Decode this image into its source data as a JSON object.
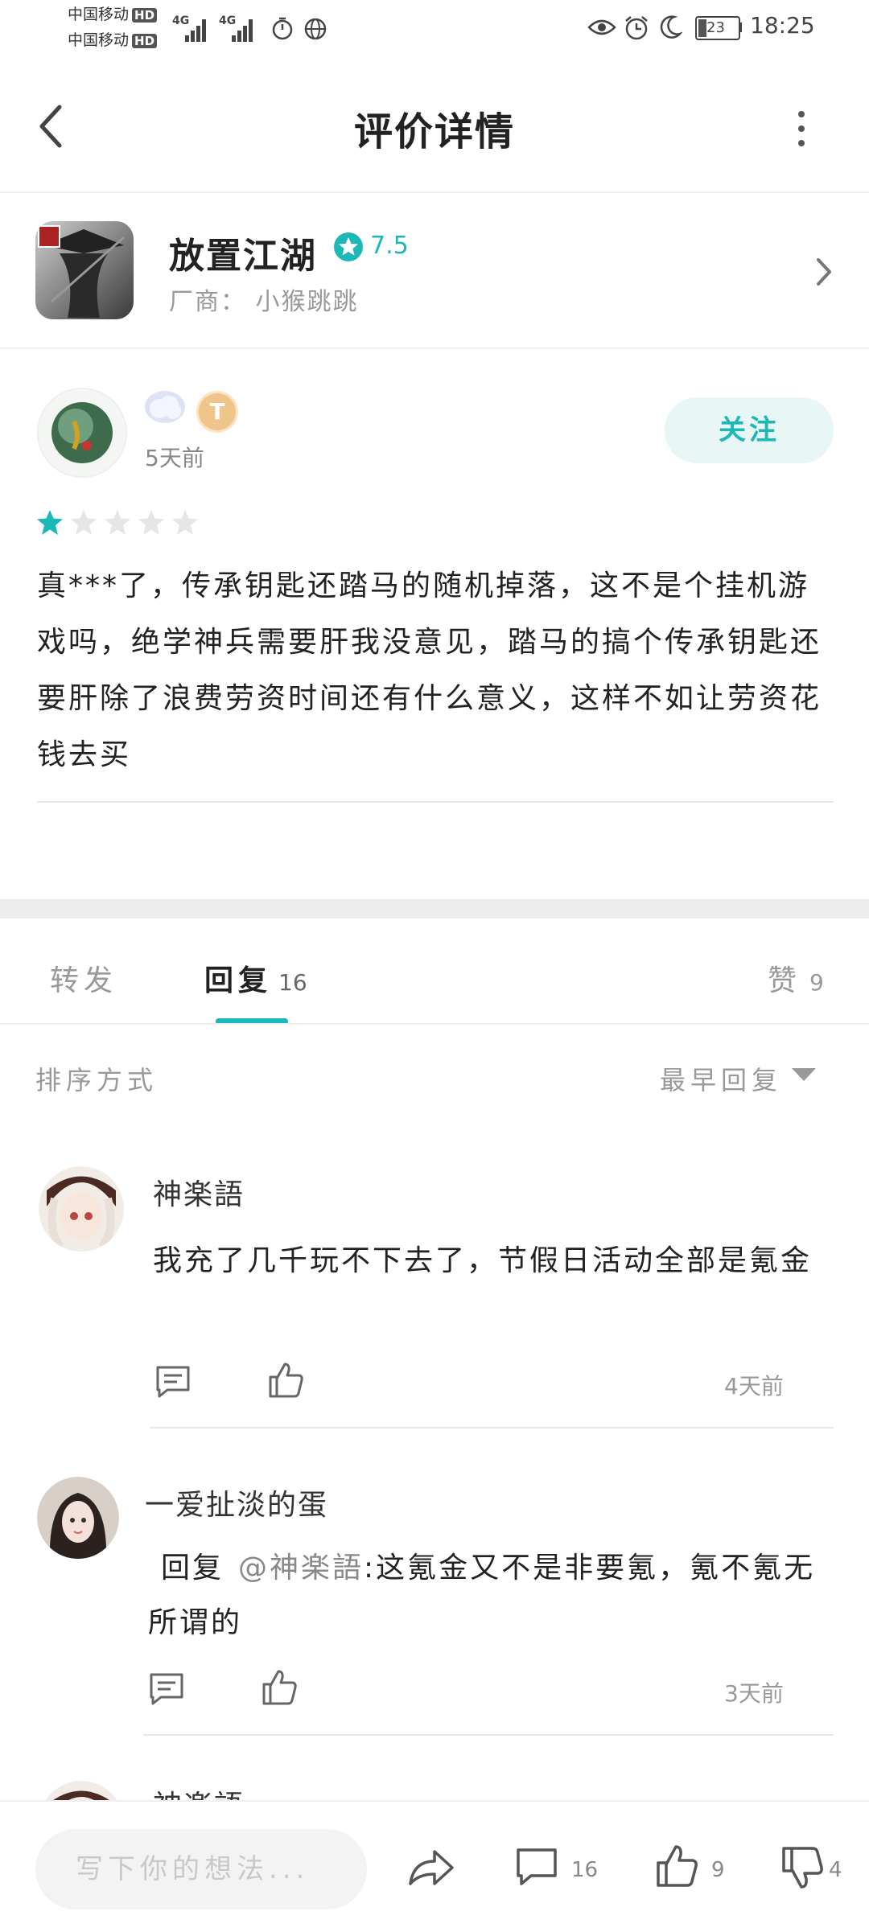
{
  "status_bar": {
    "carrier1": "中国移动",
    "carrier2": "中国移动",
    "hd": "HD",
    "net1": "4G",
    "net2": "4G",
    "battery": "23",
    "time": "18:25"
  },
  "header": {
    "title": "评价详情"
  },
  "game": {
    "name": "放置江湖",
    "score": "7.5",
    "maker": "厂商： 小猴跳跳"
  },
  "review": {
    "badge_letter": "T",
    "time": "5天前",
    "follow_label": "关注",
    "stars": 1,
    "stars_max": 5,
    "text": "真***了，传承钥匙还踏马的随机掉落，这不是个挂机游戏吗，绝学神兵需要肝我没意见，踏马的搞个传承钥匙还要肝除了浪费劳资时间还有什么意义，这样不如让劳资花钱去买"
  },
  "tabs": {
    "forward": "转发",
    "reply": "回复",
    "reply_count": "16",
    "like": "赞",
    "like_count": "9"
  },
  "sort": {
    "label": "排序方式",
    "value": "最早回复"
  },
  "replies": [
    {
      "user": "神楽語",
      "text": "我充了几千玩不下去了，节假日活动全部是氪金",
      "time": "4天前"
    },
    {
      "user": "一爱扯淡的蛋",
      "prefix": "回复",
      "mention": "@神楽語",
      "text": ":这氪金又不是非要氪，氪不氪无所谓的",
      "time": "3天前"
    },
    {
      "user": "神楽語"
    }
  ],
  "bottom": {
    "placeholder": "写下你的想法...",
    "comment_count": "16",
    "like_count": "9",
    "dislike_count": "4"
  },
  "colors": {
    "accent": "#1cb8b8",
    "follow_bg": "#e8f6f6"
  }
}
